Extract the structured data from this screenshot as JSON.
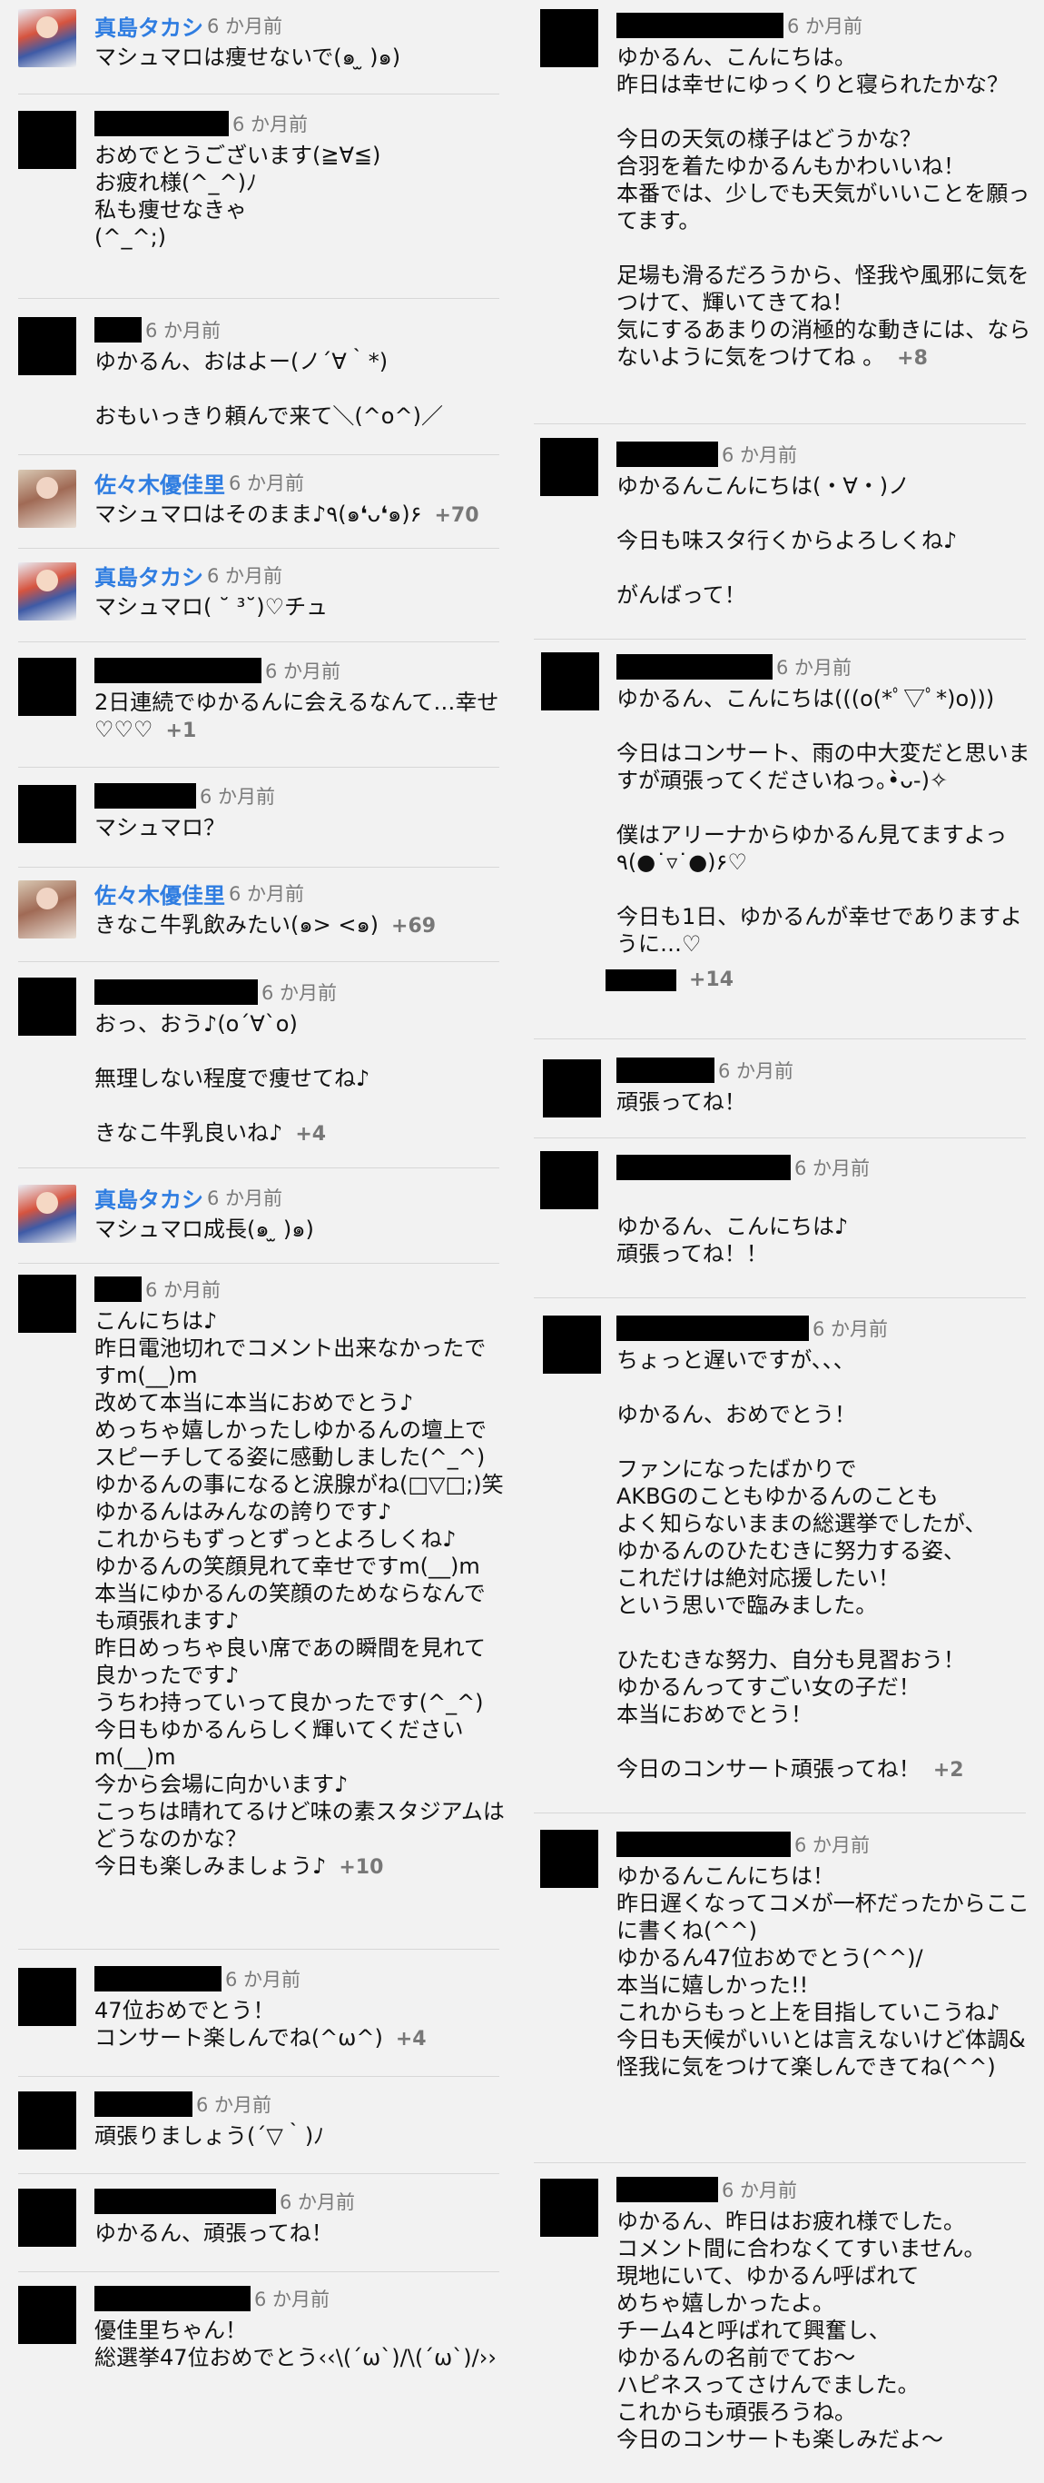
{
  "time_label": "6 か月前",
  "left": [
    {
      "name": "真島タカシ",
      "name_shown": true,
      "redact_w": 0,
      "avatar": "photo",
      "text": "マシュマロは痩せないで(๑ ̫ )๑)",
      "likes": ""
    },
    {
      "name": "",
      "name_shown": false,
      "redact_w": 148,
      "avatar": "black",
      "text": "おめでとうございます(≧∀≦)\nお疲れ様(^_^)ﾉ\n私も痩せなきゃ\n(^_^;)",
      "likes": ""
    },
    {
      "name": "",
      "name_shown": false,
      "redact_w": 52,
      "avatar": "black",
      "text": "ゆかるん、おはよー(ノ´∀｀*)\n\nおもいっきり頼んで来て＼(^o^)／",
      "likes": ""
    },
    {
      "name": "佐々木優佳里",
      "name_shown": true,
      "redact_w": 0,
      "avatar": "photo2",
      "text": "マシュマロはそのまま♪٩(๑❛ᴗ❛๑)۶",
      "likes": "+70"
    },
    {
      "name": "真島タカシ",
      "name_shown": true,
      "redact_w": 0,
      "avatar": "photo",
      "text": "マシュマロ( ˘ ³˘)♡チュ",
      "likes": ""
    },
    {
      "name": "",
      "name_shown": false,
      "redact_w": 184,
      "avatar": "black",
      "text": "2日連続でゆかるんに会えるなんて…幸せ♡♡♡",
      "likes": "+1"
    },
    {
      "name": "",
      "name_shown": false,
      "redact_w": 112,
      "avatar": "black",
      "text": "マシュマロ？",
      "likes": ""
    },
    {
      "name": "佐々木優佳里",
      "name_shown": true,
      "redact_w": 0,
      "avatar": "photo2",
      "text": "きなこ牛乳飲みたい(๑> <๑)",
      "likes": "+69"
    },
    {
      "name": "",
      "name_shown": false,
      "redact_w": 180,
      "avatar": "black",
      "text": "おっ、おう♪(o´∀`o)\n\n無理しない程度で痩せてね♪\n\nきなこ牛乳良いね♪",
      "likes": "+4"
    },
    {
      "name": "真島タカシ",
      "name_shown": true,
      "redact_w": 0,
      "avatar": "photo",
      "text": "マシュマロ成長(๑ ̫ )๑)",
      "likes": ""
    },
    {
      "name": "",
      "name_shown": false,
      "redact_w": 52,
      "avatar": "black",
      "text": "こんにちは♪\n昨日電池切れでコメント出来なかったですm(__)m\n改めて本当に本当におめでとう♪\nめっちゃ嬉しかったしゆかるんの壇上でスピーチしてる姿に感動しました(^_^)\nゆかるんの事になると涙腺がね(□▽□;)笑\nゆかるんはみんなの誇りです♪\nこれからもずっとずっとよろしくね♪\nゆかるんの笑顔見れて幸せですm(__)m\n本当にゆかるんの笑顔のためならなんでも頑張れます♪\n昨日めっちゃ良い席であの瞬間を見れて良かったです♪\nうちわ持っていって良かったです(^_^)\n今日もゆかるんらしく輝いてくださいm(__)m\n今から会場に向かいます♪\nこっちは晴れてるけど味の素スタジアムはどうなのかな？\n今日も楽しみましょう♪",
      "likes": "+10"
    },
    {
      "name": "",
      "name_shown": false,
      "redact_w": 140,
      "avatar": "black",
      "text": "47位おめでとう！\nコンサート楽しんでね(^ω^)",
      "likes": "+4"
    },
    {
      "name": "",
      "name_shown": false,
      "redact_w": 108,
      "avatar": "black",
      "text": "頑張りましょう(´▽｀)ﾉ",
      "likes": ""
    },
    {
      "name": "",
      "name_shown": false,
      "redact_w": 200,
      "avatar": "black",
      "text": "ゆかるん、頑張ってね！",
      "likes": ""
    },
    {
      "name": "",
      "name_shown": false,
      "redact_w": 172,
      "avatar": "black",
      "text": "優佳里ちゃん！\n総選挙47位おめでとう‹‹\\(´ω`)/\\(´ω`)/››",
      "likes": ""
    }
  ],
  "right": [
    {
      "name": "",
      "name_shown": false,
      "redact_w": 184,
      "avatar": "black",
      "text": "ゆかるん、こんにちは。\n昨日は幸せにゆっくりと寝られたかな？\n\n今日の天気の様子はどうかな？\n合羽を着たゆかるんもかわいいね！\n本番では、少しでも天気がいいことを願ってます。\n\n足場も滑るだろうから、怪我や風邪に気をつけて、輝いてきてね！\n気にするあまりの消極的な動きには、ならないように気をつけてね 。",
      "likes": "+8"
    },
    {
      "name": "",
      "name_shown": false,
      "redact_w": 112,
      "avatar": "black",
      "text": "ゆかるんこんにちは(・∀・)ノ\n\n今日も味スタ行くからよろしくね♪\n\nがんばって！",
      "likes": ""
    },
    {
      "name": "",
      "name_shown": false,
      "redact_w": 172,
      "avatar": "black",
      "text": "ゆかるん、こんにちは(((o(*ﾟ▽ﾟ*)o)))\n\n今日はコンサート、雨の中大変だと思いますが頑張ってくださいねっ｡•̀ᴗ-)✧\n\n僕はアリーナからゆかるん見てますよっ٩(●˙▿˙●)۶♡\n\n今日も1日、ゆかるんが幸せでありますように…♡",
      "likes": "+14",
      "likes_own_line": true,
      "likes_redact_w": 78
    },
    {
      "name": "",
      "name_shown": false,
      "redact_w": 108,
      "avatar": "black",
      "text": "頑張ってね！",
      "likes": ""
    },
    {
      "name": "",
      "name_shown": false,
      "redact_w": 192,
      "avatar": "black",
      "text": "\nゆかるん、こんにちは♪\n頑張ってね！！",
      "likes": ""
    },
    {
      "name": "",
      "name_shown": false,
      "redact_w": 212,
      "avatar": "black",
      "text": "ちょっと遅いですが、、、\n\nゆかるん、おめでとう！\n\nファンになったばかりで\nAKBGのこともゆかるんのことも\nよく知らないままの総選挙でしたが、\nゆかるんのひたむきに努力する姿、\nこれだけは絶対応援したい！\nという思いで臨みました。\n\nひたむきな努力、自分も見習おう！\nゆかるんってすごい女の子だ！\n本当におめでとう！\n\n今日のコンサート頑張ってね！",
      "likes": "+2"
    },
    {
      "name": "",
      "name_shown": false,
      "redact_w": 192,
      "avatar": "black",
      "text": "ゆかるんこんにちは！\n昨日遅くなってコメが一杯だったからここに書くね(^^)\nゆかるん47位おめでとう(^^)/\n本当に嬉しかった!!\nこれからもっと上を目指していこうね♪\n今日も天候がいいとは言えないけど体調&怪我に気をつけて楽しんできてね(^^)",
      "likes": ""
    },
    {
      "name": "",
      "name_shown": false,
      "redact_w": 112,
      "avatar": "black",
      "text": "ゆかるん、昨日はお疲れ様でした。\nコメント間に合わなくてすいません。\n現地にいて、ゆかるん呼ばれて\nめちゃ嬉しかったよ。\nチーム4と呼ばれて興奮し、\nゆかるんの名前でてお〜\nハピネスってさけんでました。\nこれからも頑張ろうね。\n今日のコンサートも楽しみだよ〜",
      "likes": ""
    }
  ]
}
